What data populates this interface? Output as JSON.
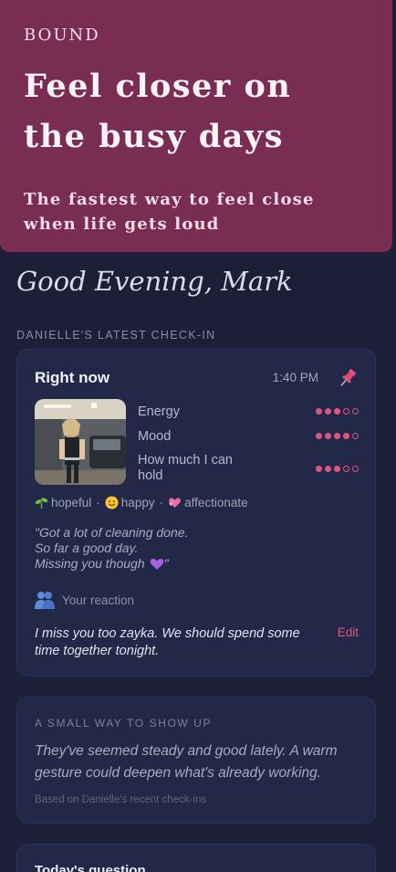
{
  "banner": {
    "brand": "BOUND",
    "headline": "Feel closer on the busy days",
    "subline": "The fastest way to feel close when life gets loud"
  },
  "greeting": "Good Evening, Mark",
  "checkin_section_label": "DANIELLE'S LATEST CHECK-IN",
  "checkin": {
    "title": "Right now",
    "time": "1:40 PM",
    "metrics": [
      {
        "label": "Energy",
        "value": 3,
        "max": 5
      },
      {
        "label": "Mood",
        "value": 4,
        "max": 5
      },
      {
        "label": "How much I can hold",
        "value": 3,
        "max": 5
      }
    ],
    "tags": [
      {
        "icon": "seedling-icon",
        "label": "hopeful"
      },
      {
        "icon": "smile-icon",
        "label": "happy"
      },
      {
        "icon": "heart-ribbon-icon",
        "label": "affectionate"
      }
    ],
    "note_line1": "\"Got a lot of cleaning done.",
    "note_line2": "So far a good day.",
    "note_line3": "Missing you though",
    "reaction_label": "Your reaction",
    "reply": "I miss you too zayka. We should spend some time together tonight.",
    "edit_label": "Edit"
  },
  "gesture": {
    "label": "A SMALL WAY TO SHOW UP",
    "text": "They've seemed steady and good lately. A warm gesture could deepen what's already working.",
    "note": "Based on Danielle's recent check-ins"
  },
  "question": {
    "title": "Today's question"
  },
  "colors": {
    "background": "#1c1f35",
    "card": "#222848",
    "banner": "#7a2d52",
    "accent": "#e0557e"
  }
}
